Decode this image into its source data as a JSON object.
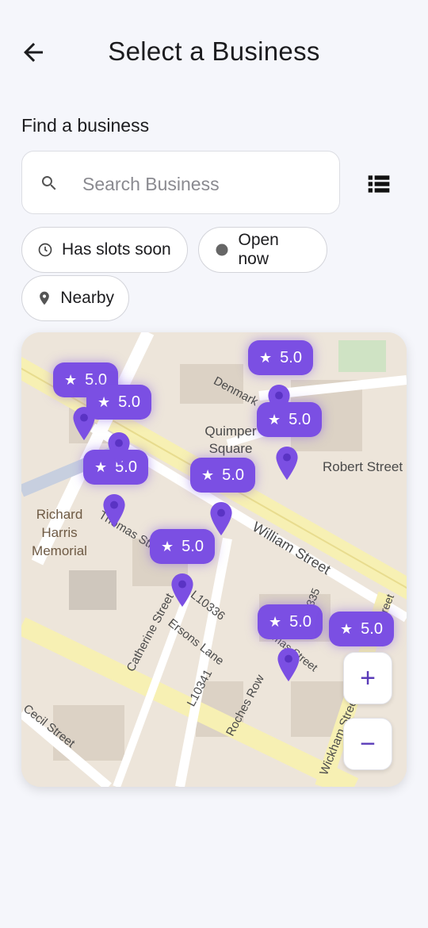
{
  "header": {
    "title": "Select a Business"
  },
  "search": {
    "label": "Find a business",
    "placeholder": "Search Business"
  },
  "filters": [
    {
      "label": "Has slots soon",
      "icon": "clock-icon"
    },
    {
      "label": "Open now",
      "icon": "dot-icon"
    },
    {
      "label": "Nearby",
      "icon": "location-icon"
    }
  ],
  "map": {
    "ratings": [
      "5.0",
      "5.0",
      "5.0",
      "5.0",
      "5.0",
      "5.0",
      "5.0",
      "5.0",
      "5.0"
    ],
    "labels": {
      "quimper": "Quimper Square",
      "robert": "Robert Street",
      "william": "William Street",
      "richard": "Richard Harris Memorial",
      "thomas": "Thomas Street",
      "catherine": "Catherine Street",
      "ersons": "Ersons Lane",
      "l10336": "L10336",
      "l10341": "L10341",
      "roches": "Roches Row",
      "cecil": "Cecil Street",
      "denmark": "Denmark",
      "wickham": "Wickham Street",
      "num335": "335",
      "thomasb": "Thomas Street",
      "rstreet": "Street"
    },
    "accent": "#7b4fe3"
  },
  "zoom": {
    "in": "+",
    "out": "−"
  }
}
